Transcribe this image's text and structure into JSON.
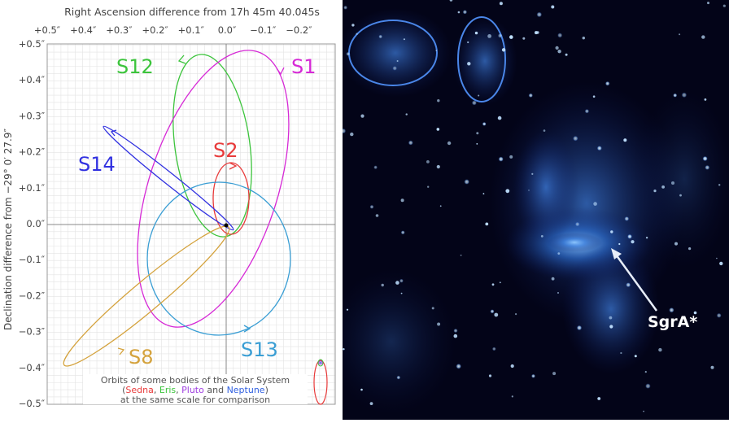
{
  "orbit_plot": {
    "top_title": "Right Ascension difference from 17h 45m 40.045s",
    "x_ticks": [
      "+0.5″",
      "+0.4″",
      "+0.3″",
      "+0.2″",
      "+0.1″",
      "0.0″",
      "−0.1″",
      "−0.2″"
    ],
    "y_ticks": [
      "+0.5″",
      "+0.4″",
      "+0.3″",
      "+0.2″",
      "+0.1″",
      "0.0″",
      "−0.1″",
      "−0.2″",
      "−0.3″",
      "−0.4″",
      "−0.5″"
    ],
    "y_axis_label": "Declination difference from −29° 0′ 27.9″",
    "stars": [
      {
        "label": "S12",
        "color": "#3cc43c"
      },
      {
        "label": "S1",
        "color": "#d629d6"
      },
      {
        "label": "S2",
        "color": "#e83a3a"
      },
      {
        "label": "S14",
        "color": "#3030e0"
      },
      {
        "label": "S13",
        "color": "#3a9ed4"
      },
      {
        "label": "S8",
        "color": "#d4a23c"
      }
    ],
    "legend": {
      "line1": "Orbits of some bodies of the Solar System",
      "open_paren": "(",
      "sedna": "Sedna",
      "sep1": ", ",
      "eris": "Eris",
      "sep2": ", ",
      "pluto": "Pluto",
      "and": " and ",
      "neptune": "Neptune",
      "close_paren": ")",
      "line3": "at the same scale for comparison",
      "colors": {
        "sedna": "#e83a3a",
        "eris": "#3cc43c",
        "pluto": "#a040e0",
        "neptune": "#3060e0",
        "text": "#555555"
      }
    }
  },
  "sky_image": {
    "pointer_label": "SgrA*"
  }
}
